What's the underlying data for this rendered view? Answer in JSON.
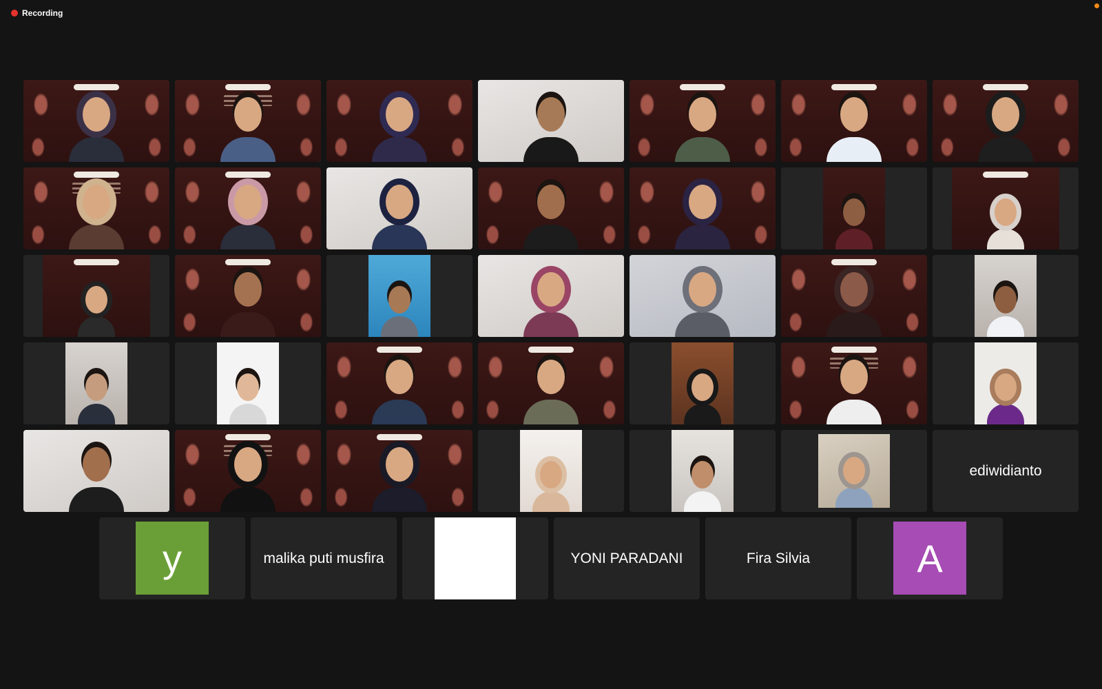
{
  "recording": {
    "label": "Recording",
    "dot_color": "#e5322d"
  },
  "accent_colors": {
    "active_speaker_border": "#2ed158",
    "tile_bg": "#242424",
    "page_bg": "#141414"
  },
  "name_tiles": [
    {
      "type": "avatar",
      "letter": "y",
      "color": "#6a9f37"
    },
    {
      "type": "name",
      "label": "malika puti musfira"
    },
    {
      "type": "white"
    },
    {
      "type": "name",
      "label": "YONI PARADANI"
    },
    {
      "type": "name",
      "label": "Fira Silvia"
    },
    {
      "type": "avatar",
      "letter": "A",
      "color": "#a64cb4"
    }
  ],
  "grid_name_tile": {
    "label": "ediwidianto"
  }
}
